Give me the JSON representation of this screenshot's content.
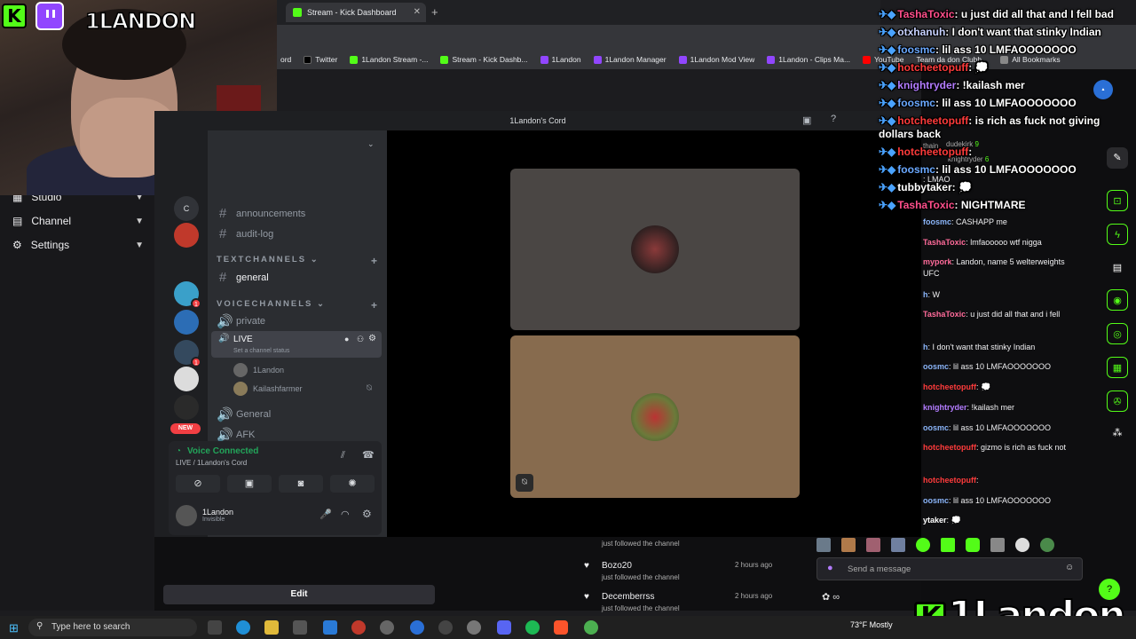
{
  "browser": {
    "active_tab": "Stream - Kick Dashboard",
    "new_tab": "+",
    "close": "✕",
    "bookmarks": [
      {
        "label": "ord",
        "color": "#5865f2"
      },
      {
        "label": "Twitter",
        "color": "#000000"
      },
      {
        "label": "1Landon Stream -...",
        "color": "#53fc18"
      },
      {
        "label": "Stream - Kick Dashb...",
        "color": "#53fc18"
      },
      {
        "label": "1Landon",
        "color": "#9146ff"
      },
      {
        "label": "1Landon Manager",
        "color": "#9146ff"
      },
      {
        "label": "1Landon Mod View",
        "color": "#9146ff"
      },
      {
        "label": "1Landon - Clips Ma...",
        "color": "#9146ff"
      },
      {
        "label": "YouTube",
        "color": "#ff0000"
      },
      {
        "label": "Team da don Clubh...",
        "color": "#888888"
      }
    ],
    "all_bookmarks": "All Bookmarks"
  },
  "webcam": {
    "streamer_name": "1LANDON",
    "kick_letter": "K"
  },
  "dashboard_menu": {
    "items": [
      {
        "label": "Studio"
      },
      {
        "label": "Channel"
      },
      {
        "label": "Settings"
      }
    ],
    "edit_label": "Edit"
  },
  "discord": {
    "window_title": "1Landon's Cord",
    "server_letter": "C",
    "channels": {
      "announcements": "announcements",
      "audit_log": "audit-log",
      "text_category": "TEXTCHANNELS",
      "general_text": "general",
      "voice_category": "VOICECHANNELS",
      "private": "private",
      "live": "LIVE",
      "live_status": "Set a channel status",
      "member1": "1Landon",
      "member2": "Kailashfarmer",
      "general_voice": "General",
      "afk": "AFK"
    },
    "new_badge": "NEW",
    "server_badges": [
      "1",
      "1"
    ],
    "voice_panel": {
      "status": "Voice Connected",
      "location": "LIVE / 1Landon's Cord"
    },
    "user": {
      "name": "1Landon",
      "status": "Invisible"
    }
  },
  "kick_followers": [
    {
      "name": "",
      "action": "just followed the channel",
      "ago": ""
    },
    {
      "name": "Bozo20",
      "action": "just followed the channel",
      "ago": "2 hours ago"
    },
    {
      "name": "Decemberrss",
      "action": "just followed the channel",
      "ago": "2 hours ago"
    }
  ],
  "kick_chat_header": {
    "viewer1": "dudekirk",
    "count1": "9",
    "viewer2": "knightryder",
    "count2": "6",
    "team": "thain"
  },
  "kick_chat": [
    {
      "user": "",
      "text": "LMAO",
      "color": "#53fc18"
    },
    {
      "user": "foosmc",
      "text": "CASHAPP me",
      "color": "#8ab4f8"
    },
    {
      "user": "TashaToxic",
      "text": "lmfaooooo wtf nigga",
      "color": "#ff6b9a"
    },
    {
      "user": "mypork",
      "text": "Landon, name 5 welterweights UFC",
      "color": "#ff6b9a"
    },
    {
      "user": "h",
      "text": "W",
      "color": "#8ab4f8"
    },
    {
      "user": "TashaToxic",
      "text": "u just did all that and i fell",
      "color": "#ff6b9a"
    },
    {
      "user": "h",
      "text": "I don't want that stinky Indian",
      "color": "#8ab4f8"
    },
    {
      "user": "oosmc",
      "text": "lil ass 10 LMFAOOOOOOO",
      "color": "#8ab4f8"
    },
    {
      "user": "hotcheetopuff",
      "text": "💭",
      "color": "#ff3b3b"
    },
    {
      "user": "knightryder",
      "text": "!kailash mer",
      "color": "#b37cff"
    },
    {
      "user": "oosmc",
      "text": "lil ass 10 LMFAOOOOOOO",
      "color": "#8ab4f8"
    },
    {
      "user": "hotcheetopuff",
      "text": "gizmo is rich as fuck not",
      "color": "#ff3b3b"
    },
    {
      "user": "hotcheetopuff",
      "text": "",
      "color": "#ff3b3b"
    },
    {
      "user": "oosmc",
      "text": "lil ass 10 LMFAOOOOOOO",
      "color": "#8ab4f8"
    },
    {
      "user": "ytaker",
      "text": "💭",
      "color": "#ffffff"
    }
  ],
  "chat_input_placeholder": "Send a message",
  "overlay_chat": [
    {
      "user": "TashaToxic",
      "text": "u just did all that and I fell bad",
      "color": "#ff4f8b"
    },
    {
      "user": "otxhanuh",
      "text": "I don't want that stinky Indian",
      "color": "#c7d2ff"
    },
    {
      "user": "foosmc",
      "text": "lil ass 10 LMFAOOOOOOO",
      "color": "#6aa8ff"
    },
    {
      "user": "hotcheetopuff",
      "text": "💭",
      "color": "#ff3b3b"
    },
    {
      "user": "knightryder",
      "text": "!kailash mer",
      "color": "#b37cff"
    },
    {
      "user": "foosmc",
      "text": "lil ass 10 LMFAOOOOOOO",
      "color": "#6aa8ff"
    },
    {
      "user": "hotcheetopuff",
      "text": "is rich as fuck not giving",
      "color": "#ff3b3b"
    },
    {
      "user": "",
      "text": "dollars back",
      "color": "#ffffff"
    },
    {
      "user": "hotcheetopuff",
      "text": "",
      "color": "#ff3b3b"
    },
    {
      "user": "foosmc",
      "text": "lil ass 10 LMFAOOOOOOO",
      "color": "#6aa8ff"
    },
    {
      "user": "tubbytaker",
      "text": "💭",
      "color": "#ffffff"
    },
    {
      "user": "TashaToxic",
      "text": "NIGHTMARE",
      "color": "#ff4f8b"
    }
  ],
  "taskbar": {
    "search_placeholder": "Type here to search",
    "weather": "73°F  Mostly"
  },
  "bottom_logo": "1Landon"
}
